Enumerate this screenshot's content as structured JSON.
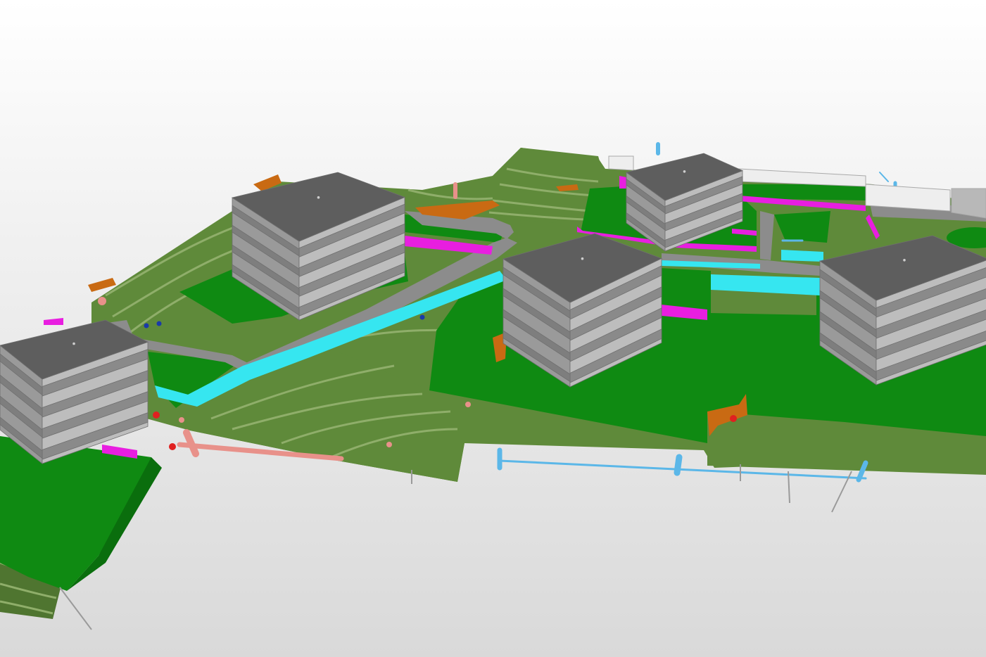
{
  "viewer": {
    "background_top": "#ffffff",
    "background_bottom": "#d9d9d9"
  },
  "palette": {
    "terrain_olive": "#5f8a3a",
    "terrain_olive_dark": "#4f7530",
    "terrain_line": "#8fae6a",
    "lawn_green": "#0f8a12",
    "lawn_green_dark": "#0a6e0d",
    "roof_grey": "#5e5e5e",
    "slab_grey": "#bdbdbd",
    "wall_grey": "#9a9a9a",
    "path_grey": "#8c8c8c",
    "water_cyan": "#36e6f0",
    "pipe_blue": "#5bb7e8",
    "pipe_pink": "#e8918a",
    "wall_magenta": "#e81ee0",
    "earth_orange": "#c96a13",
    "marker_red": "#e02020",
    "marker_navy": "#1a3aa8"
  },
  "model": {
    "buildings": [
      {
        "id": "building-west",
        "floors": 4
      },
      {
        "id": "building-northwest",
        "floors": 4
      },
      {
        "id": "building-north",
        "floors": 3
      },
      {
        "id": "building-center",
        "floors": 4
      },
      {
        "id": "building-east",
        "floors": 4
      }
    ],
    "icons": {
      "building": "building-block-icon",
      "pipe": "utility-pipe-icon",
      "marker": "survey-marker-icon"
    }
  }
}
